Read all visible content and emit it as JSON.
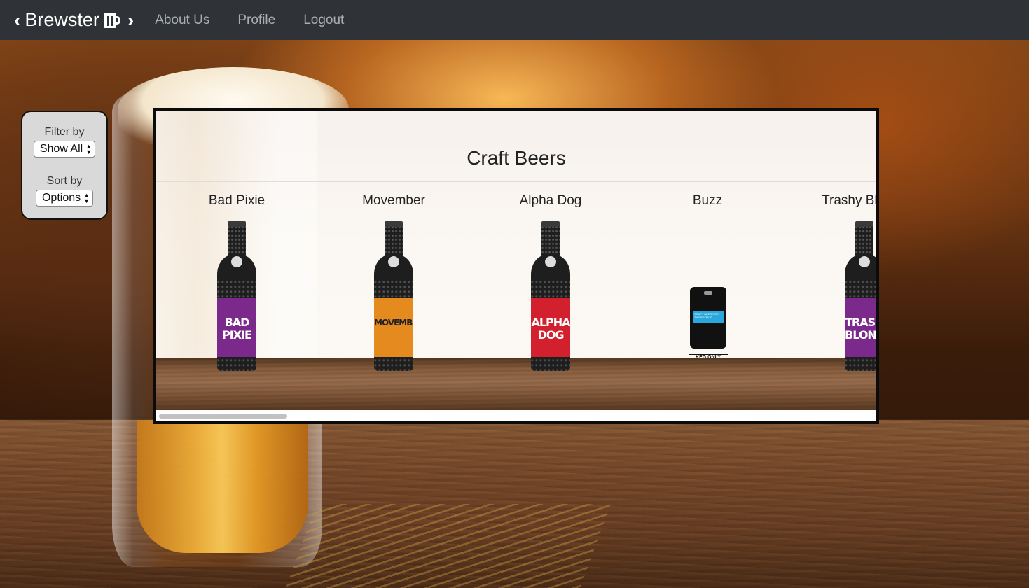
{
  "navbar": {
    "brand": "Brewster",
    "links": [
      "About Us",
      "Profile",
      "Logout"
    ]
  },
  "filter_panel": {
    "filter_label": "Filter by",
    "filter_value": "Show All",
    "sort_label": "Sort by",
    "sort_value": "Options"
  },
  "beer_box": {
    "title": "Craft Beers",
    "beers": [
      {
        "name": "Bad Pixie",
        "label_text": "BAD PIXIE",
        "label_color": "#7b2a8c"
      },
      {
        "name": "Movember",
        "label_text": "MOVEMBER",
        "label_color": "#e58a1f"
      },
      {
        "name": "Alpha Dog",
        "label_text": "ALPHA DOG",
        "label_color": "#d2202f"
      },
      {
        "name": "Buzz",
        "keg_sign": "KEG ONLY",
        "keg_strip_text": "CRAFT BEER FOR THE PEOPLE",
        "keg_color": "#2aa7dc"
      },
      {
        "name": "Trashy Blonde",
        "label_text": "TRASHY BLONDE",
        "label_color": "#7b2a8c"
      }
    ]
  },
  "colors": {
    "navbar_bg": "#2f3337",
    "nav_link": "#a9aeb2",
    "panel_bg": "#d9d9d9"
  },
  "icons": {
    "prev": "chevron-left-icon",
    "next": "chevron-right-icon",
    "logo": "beer-mug-icon"
  }
}
